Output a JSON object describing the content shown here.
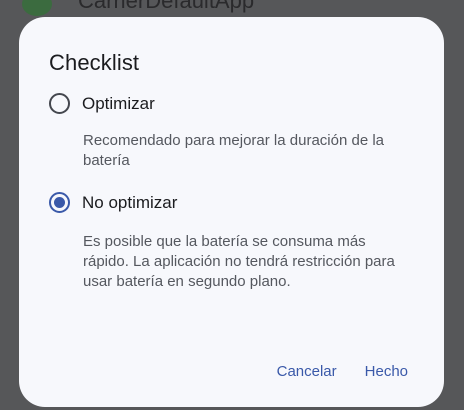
{
  "background_app": {
    "title": "CarrierDefaultApp"
  },
  "dialog": {
    "title": "Checklist",
    "options": [
      {
        "label": "Optimizar",
        "description": "Recomendado para mejorar la duración de la batería",
        "selected": false
      },
      {
        "label": "No optimizar",
        "description": "Es posible que la batería se consuma más rápido. La aplicación no tendrá restricción para usar batería en segundo plano.",
        "selected": true
      }
    ],
    "cancel_label": "Cancelar",
    "done_label": "Hecho"
  },
  "colors": {
    "accent": "#3a59a9",
    "dialog_background": "#f7f8fc",
    "scrim": "#565759"
  }
}
